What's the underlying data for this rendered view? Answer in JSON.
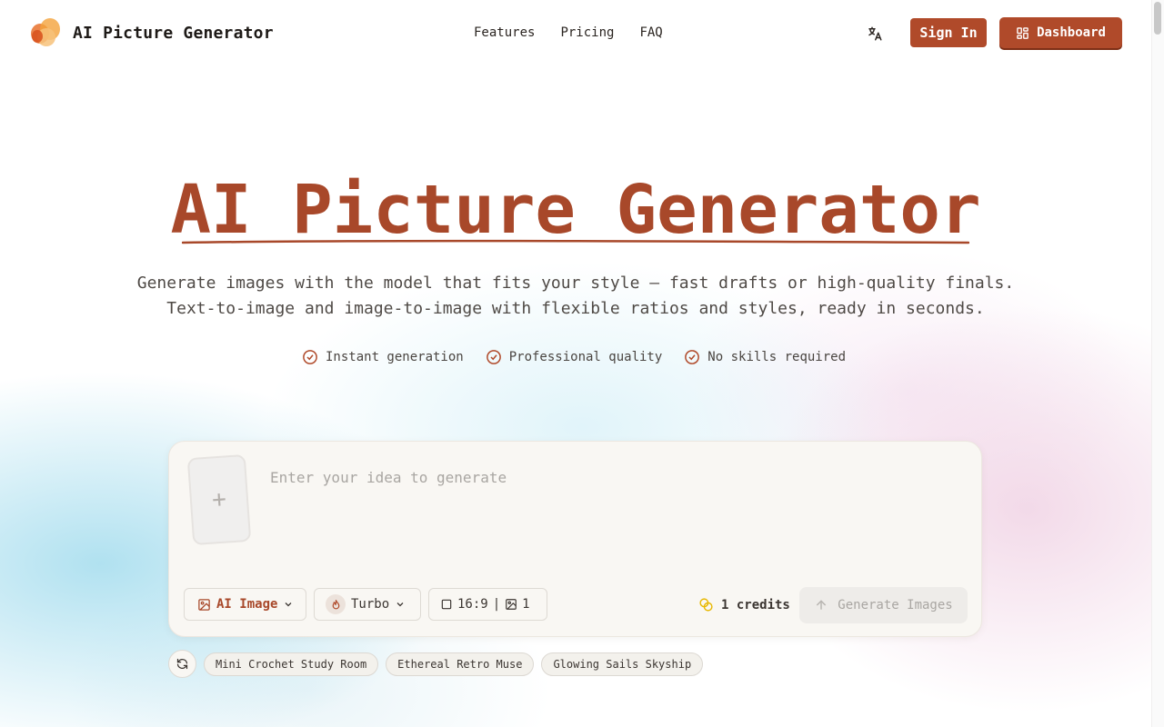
{
  "brand": {
    "name": "AI Picture Generator"
  },
  "nav": {
    "items": [
      "Features",
      "Pricing",
      "FAQ"
    ]
  },
  "header": {
    "translate_icon": "translate-icon",
    "signin_label": "Sign In",
    "dashboard_label": "Dashboard"
  },
  "hero": {
    "title": "AI Picture Generator",
    "subtitle_line1": "Generate images with the model that fits your style — fast drafts or high-quality finals.",
    "subtitle_line2": "Text-to-image and image-to-image with flexible ratios and styles, ready in seconds.",
    "features": [
      "Instant generation",
      "Professional quality",
      "No skills required"
    ]
  },
  "generator": {
    "upload_icon": "plus-icon",
    "prompt_placeholder": "Enter your idea to generate",
    "prompt_value": "",
    "mode_label": "AI Image",
    "model_label": "Turbo",
    "ratio_label": "16:9",
    "ratio_separator": "|",
    "count_label": "1",
    "credits_label": "1 credits",
    "generate_label": "Generate Images"
  },
  "suggestions": [
    "Mini Crochet Study Room",
    "Ethereal Retro Muse",
    "Glowing Sails Skyship"
  ],
  "colors": {
    "accent": "#b04a2a",
    "title": "#a8482a",
    "card_bg": "#f9f7f3",
    "credits_icon": "#e8b800"
  }
}
